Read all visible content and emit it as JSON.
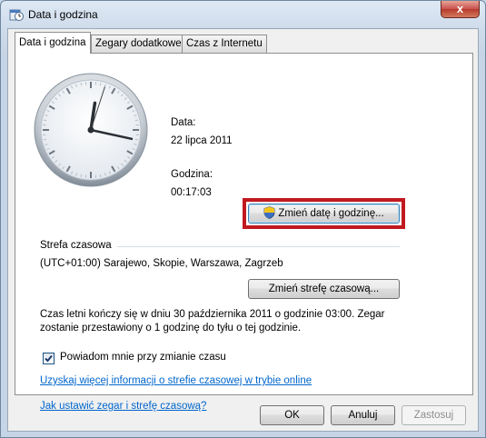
{
  "window": {
    "title": "Data i godzina",
    "close_glyph": "x",
    "icon": "clock-calendar-icon"
  },
  "tabs": [
    {
      "label": "Data i godzina",
      "active": true
    },
    {
      "label": "Zegary dodatkowe",
      "active": false
    },
    {
      "label": "Czas z Internetu",
      "active": false
    }
  ],
  "date_section": {
    "date_label": "Data:",
    "date_value": "22 lipca 2011",
    "time_label": "Godzina:",
    "time_value": "00:17:03",
    "change_button": "Zmień datę i godzinę..."
  },
  "clock": {
    "hours": 0,
    "minutes": 17,
    "seconds": 3
  },
  "timezone": {
    "heading": "Strefa czasowa",
    "value": "(UTC+01:00) Sarajewo, Skopie, Warszawa, Zagrzeb",
    "change_button": "Zmień strefę czasową..."
  },
  "dst_info": {
    "line1": "Czas letni kończy się w dniu 30 października 2011 o godzinie 03:00. Zegar",
    "line2": "zostanie przestawiony o 1 godzinę do tyłu o tej godzinie."
  },
  "notify_checkbox": {
    "label": "Powiadom mnie przy zmianie czasu",
    "checked": true
  },
  "links": {
    "more_info": "Uzyskaj więcej informacji o strefie czasowej w trybie online",
    "how_to": "Jak ustawić zegar i strefę czasową?"
  },
  "buttons": {
    "ok": "OK",
    "cancel": "Anuluj",
    "apply": "Zastosuj"
  },
  "colors": {
    "highlight": "#c0191f",
    "link": "#0066cc"
  }
}
